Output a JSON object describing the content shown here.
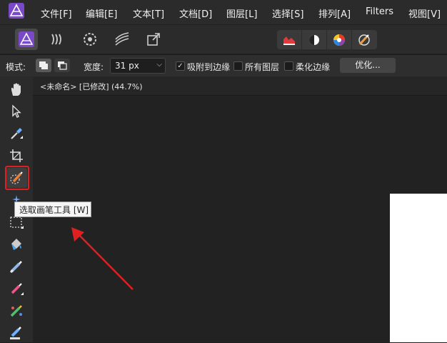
{
  "menubar": {
    "items": [
      "文件[F]",
      "编辑[E]",
      "文本[T]",
      "文档[D]",
      "图层[L]",
      "选择[S]",
      "排列[A]",
      "Filters",
      "视图[V]"
    ],
    "logo": "affinity-photo-logo"
  },
  "personas": [
    "photo-persona-icon",
    "liquify-persona-icon",
    "develop-persona-icon",
    "tone-mapping-persona-icon",
    "export-persona-icon"
  ],
  "studio_buttons": [
    "histogram-icon",
    "adjustment-icon",
    "color-wheel-icon",
    "brush-studio-icon"
  ],
  "context": {
    "mode_label": "模式:",
    "width_label": "宽度:",
    "width_value": "31 px",
    "snap_label": "吸附到边缘",
    "snap_checked": true,
    "all_layers_label": "所有图层",
    "all_layers_checked": false,
    "soften_label": "柔化边缘",
    "soften_checked": false,
    "refine_label": "优化..."
  },
  "document": {
    "tab_title": "<未命名> [已修改] (44.7%)"
  },
  "tooltip": {
    "text": "选取画笔工具 [W]"
  },
  "tools": [
    "hand-tool-icon",
    "move-tool-icon",
    "color-picker-icon",
    "crop-tool-icon",
    "selection-brush-icon",
    "flood-select-icon",
    "marquee-icon",
    "flood-fill-icon",
    "paint-brush-icon",
    "pixel-brush-icon",
    "color-replace-icon",
    "erase-brush-icon"
  ],
  "colors": {
    "accent_red": "#e02020",
    "bg_dark": "#222222"
  }
}
